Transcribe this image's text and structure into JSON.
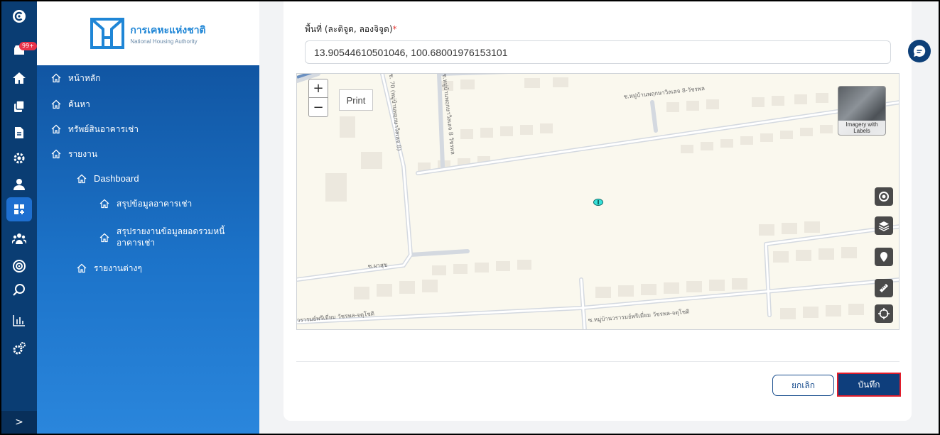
{
  "rail": {
    "badge": "99+",
    "bottom_toggle": ">",
    "icons": [
      "brand-icon",
      "inbox-icon",
      "home-icon",
      "copy-icon",
      "document-icon",
      "settings-icon",
      "user-icon",
      "dashboard-icon",
      "team-icon",
      "target-icon",
      "search-icon",
      "chart-icon",
      "gears-icon"
    ]
  },
  "logo": {
    "title_th": "การเคหะแห่งชาติ",
    "title_en": "National Housing Authority"
  },
  "menu": {
    "home": "หน้าหลัก",
    "search": "ค้นหา",
    "assets": "ทรัพย์สินอาคารเช่า",
    "reports": "รายงาน",
    "dashboard": "Dashboard",
    "summary": "สรุปข้อมูลอาคารเช่า",
    "debt_summary_line1": "สรุปรายงานข้อมูลยอดรวมหนี้",
    "debt_summary_line2": "อาคารเช่า",
    "other_reports": "รายงานต่างๆ"
  },
  "form": {
    "field_label": "พื้นที่ (ละติจูด, ลองจิจูด)",
    "required_mark": "*",
    "coordinates": "13.90544610501046, 100.68001976153101"
  },
  "map": {
    "zoom_in": "+",
    "zoom_out": "−",
    "print": "Print",
    "basemap_label": "Imagery with Labels",
    "street_labels": [
      "ซ.หมู่บ้านพฤกษาวิลเลจ 8-วัชรพล",
      "ซ.หมู่บ้านวรารมย์พรีเมี่ยม วัชรพล-จตุโชติ",
      "วรารมย์พรีเมี่ยม วัชรพล-จตุโชติ",
      "ซ.ผาสุข",
      "ซ.หมู่บ้านพฤกษาวิลเลจ 8 วัชรพล",
      "ซ. 70 (หมู่บ้านพฤกษาวิลเลจ 8)",
      "พฤกษาวิลเลจ 8 วัชรพล"
    ],
    "tools": [
      "locate-icon",
      "layers-icon",
      "pin-icon",
      "measure-icon",
      "crosshair-icon"
    ]
  },
  "actions": {
    "cancel": "ยกเลิก",
    "save": "บันทึก"
  },
  "colors": {
    "rail": "#0a3d73",
    "sidebar_top": "#0d4c96",
    "sidebar_bottom": "#2a86dc",
    "save": "#0e3e7c",
    "highlight": "#e11d2b"
  }
}
